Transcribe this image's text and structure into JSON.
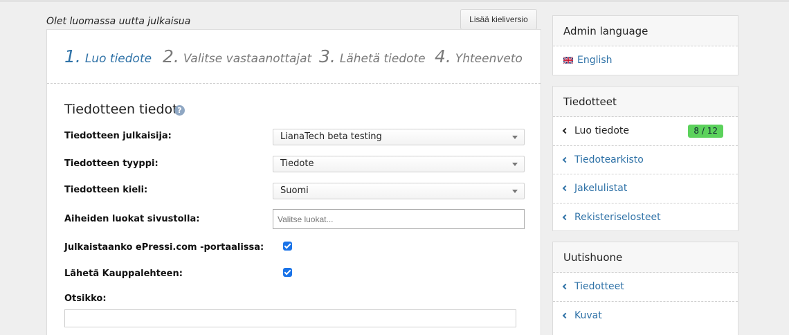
{
  "page": {
    "heading": "Olet luomassa uutta julkaisua",
    "add_language_version": "Lisää kieliversio"
  },
  "steps": [
    {
      "num": "1.",
      "label": "Luo tiedote",
      "active": true
    },
    {
      "num": "2.",
      "label": "Valitse vastaanottajat",
      "active": false
    },
    {
      "num": "3.",
      "label": "Lähetä tiedote",
      "active": false
    },
    {
      "num": "4.",
      "label": "Yhteenveto",
      "active": false
    }
  ],
  "form": {
    "section_title": "Tiedotteen tiedot",
    "help_icon": "?",
    "publisher": {
      "label": "Tiedotteen julkaisija:",
      "value": "LianaTech beta testing"
    },
    "type": {
      "label": "Tiedotteen tyyppi:",
      "value": "Tiedote"
    },
    "language": {
      "label": "Tiedotteen kieli:",
      "value": "Suomi"
    },
    "categories": {
      "label": "Aiheiden luokat sivustolla:",
      "placeholder": "Valitse luokat..."
    },
    "epressi": {
      "label": "Julkaistaanko ePressi.com -portaalissa:",
      "checked": true
    },
    "kauppalehti": {
      "label": "Lähetä Kauppalehteen:",
      "checked": true
    },
    "title": {
      "label": "Otsikko:",
      "value": ""
    }
  },
  "sidebar": {
    "admin_language": {
      "title": "Admin language",
      "current": "English",
      "flag_icon": "uk-flag-icon"
    },
    "tiedotteet": {
      "title": "Tiedotteet",
      "items": [
        {
          "label": "Luo tiedote",
          "badge": "8 / 12",
          "current": true
        },
        {
          "label": "Tiedotearkisto"
        },
        {
          "label": "Jakelulistat"
        },
        {
          "label": "Rekisteriselosteet"
        }
      ]
    },
    "uutishuone": {
      "title": "Uutishuone",
      "items": [
        {
          "label": "Tiedotteet"
        },
        {
          "label": "Kuvat"
        }
      ]
    }
  },
  "colors": {
    "link": "#2f72a7",
    "badge": "#5cd25c",
    "checkbox": "#1a73e8"
  }
}
